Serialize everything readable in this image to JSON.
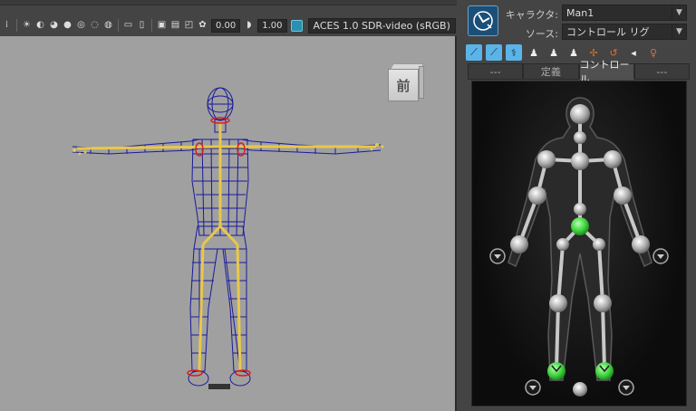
{
  "viewport": {
    "exposure": "0.00",
    "gamma": "1.00",
    "color_space": "ACES 1.0 SDR-video (sRGB)",
    "view_cube_label": "前"
  },
  "panel": {
    "character_label": "キャラクタ:",
    "character_value": "Man1",
    "source_label": "ソース:",
    "source_value": "コントロール リグ",
    "tabs": [
      "---",
      "定義",
      "コントロール",
      "---"
    ],
    "active_tab": "コントロール"
  },
  "colors": {
    "viewport_bg": "#a0a0a0",
    "wireframe": "#1a1a9a",
    "bones": "#e8c84a",
    "active_joint": "#3ad13a",
    "accent": "#5ab4e8"
  }
}
